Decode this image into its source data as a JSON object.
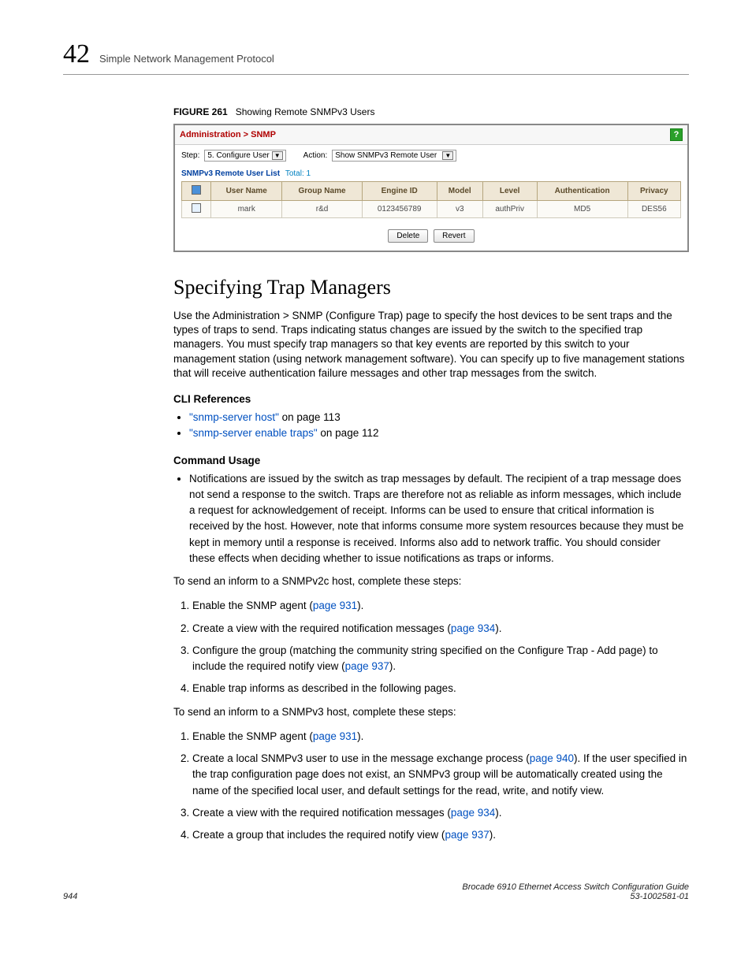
{
  "header": {
    "chapter_number": "42",
    "chapter_title": "Simple Network Management Protocol"
  },
  "figure": {
    "label": "FIGURE 261",
    "title": "Showing Remote SNMPv3 Users"
  },
  "ui": {
    "breadcrumb": "Administration > SNMP",
    "help_icon": "?",
    "step_label": "Step:",
    "step_value": "5. Configure User",
    "action_label": "Action:",
    "action_value": "Show SNMPv3 Remote User",
    "list_label": "SNMPv3 Remote User List",
    "total_label": "Total: 1",
    "cols": {
      "user": "User Name",
      "group": "Group Name",
      "engine": "Engine ID",
      "model": "Model",
      "level": "Level",
      "auth": "Authentication",
      "priv": "Privacy"
    },
    "row": {
      "user": "mark",
      "group": "r&d",
      "engine": "0123456789",
      "model": "v3",
      "level": "authPriv",
      "auth": "MD5",
      "priv": "DES56"
    },
    "btn_delete": "Delete",
    "btn_revert": "Revert"
  },
  "section": {
    "title": "Specifying Trap Managers",
    "intro": "Use the Administration > SNMP (Configure Trap) page to specify the host devices to be sent traps and the types of traps to send. Traps indicating status changes are issued by the switch to the specified trap managers. You must specify trap managers so that key events are reported by this switch to your management station (using network management software). You can specify up to five management stations that will receive authentication failure messages and other trap messages from the switch.",
    "cli_heading": "CLI References",
    "cli_1_link": "\"snmp-server host\"",
    "cli_1_suffix": " on page 113",
    "cli_2_link": "\"snmp-server enable traps\"",
    "cli_2_suffix": " on page 112",
    "usage_heading": "Command Usage",
    "usage_bullet": "Notifications are issued by the switch as trap messages by default. The recipient of a trap message does not send a response to the switch. Traps are therefore not as reliable as inform messages, which include a request for acknowledgement of receipt. Informs can be used to ensure that critical information is received by the host. However, note that informs consume more system resources because they must be kept in memory until a response is received. Informs also add to network traffic. You should consider these effects when deciding whether to issue notifications as traps or informs.",
    "v2c_lead": "To send an inform to a SNMPv2c host, complete these steps:",
    "v2c_steps": {
      "s1_a": "Enable the SNMP agent (",
      "s1_link": "page 931",
      "s1_b": ").",
      "s2_a": "Create a view with the required notification messages (",
      "s2_link": "page 934",
      "s2_b": ").",
      "s3_a": "Configure the group (matching the community string specified on the Configure Trap - Add page) to include the required notify view (",
      "s3_link": "page 937",
      "s3_b": ").",
      "s4": "Enable trap informs as described in the following pages."
    },
    "v3_lead": "To send an inform to a SNMPv3 host, complete these steps:",
    "v3_steps": {
      "s1_a": "Enable the SNMP agent (",
      "s1_link": "page 931",
      "s1_b": ").",
      "s2_a": "Create a local SNMPv3 user to use in the message exchange process (",
      "s2_link": "page 940",
      "s2_b": "). If the user specified in the trap configuration page does not exist, an SNMPv3 group will be automatically created using the name of the specified local user, and default settings for the read, write, and notify view.",
      "s3_a": "Create a view with the required notification messages (",
      "s3_link": "page 934",
      "s3_b": ").",
      "s4_a": "Create a group that includes the required notify view (",
      "s4_link": "page 937",
      "s4_b": ")."
    }
  },
  "footer": {
    "page": "944",
    "doc": "Brocade 6910 Ethernet Access Switch Configuration Guide",
    "docnum": "53-1002581-01"
  }
}
